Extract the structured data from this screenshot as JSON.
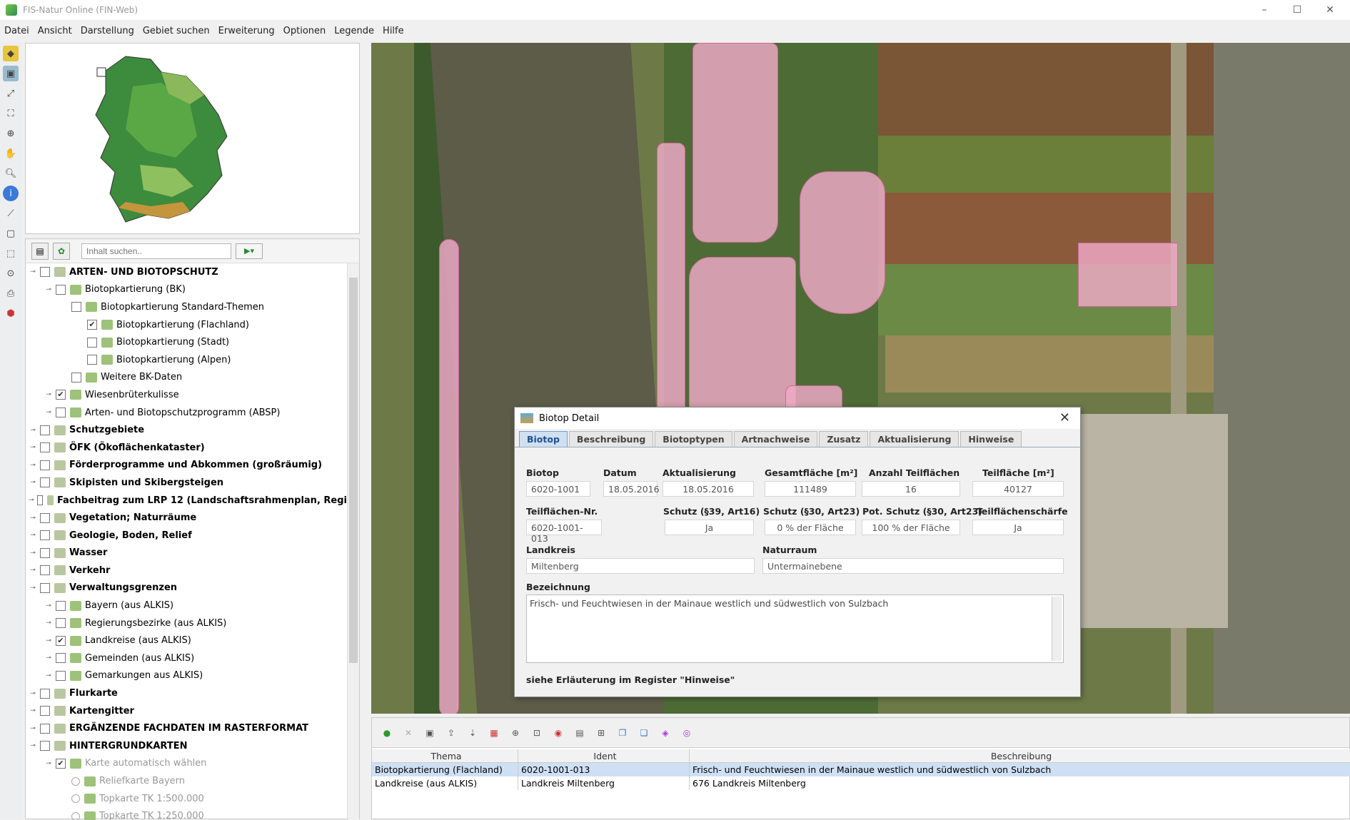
{
  "window": {
    "title": "FIS-Natur Online (FIN-Web)",
    "minimize": "–",
    "maximize": "☐",
    "close": "✕"
  },
  "menu": [
    "Datei",
    "Ansicht",
    "Darstellung",
    "Gebiet suchen",
    "Erweiterung",
    "Optionen",
    "Legende",
    "Hilfe"
  ],
  "tree": {
    "search_placeholder": "Inhalt suchen..",
    "items": [
      {
        "label": "ARTEN- UND BIOTOPSCHUTZ",
        "indent": 0,
        "checked": false,
        "bold": true
      },
      {
        "label": "Biotopkartierung (BK)",
        "indent": 1,
        "checked": false
      },
      {
        "label": "Biotopkartierung Standard-Themen",
        "indent": 2,
        "checked": false
      },
      {
        "label": "Biotopkartierung (Flachland)",
        "indent": 3,
        "checked": true
      },
      {
        "label": "Biotopkartierung (Stadt)",
        "indent": 3,
        "checked": false
      },
      {
        "label": "Biotopkartierung (Alpen)",
        "indent": 3,
        "checked": false
      },
      {
        "label": "Weitere BK-Daten",
        "indent": 2,
        "checked": false
      },
      {
        "label": "Wiesenbrüterkulisse",
        "indent": 1,
        "checked": true
      },
      {
        "label": "Arten- und Biotopschutzprogramm (ABSP)",
        "indent": 1,
        "checked": false
      },
      {
        "label": "Schutzgebiete",
        "indent": 0,
        "checked": false,
        "bold": true
      },
      {
        "label": "ÖFK (Ökoflächenkataster)",
        "indent": 0,
        "checked": false,
        "bold": true
      },
      {
        "label": "Förderprogramme und Abkommen (großräumig)",
        "indent": 0,
        "checked": false,
        "bold": true
      },
      {
        "label": "Skipisten und Skibergsteigen",
        "indent": 0,
        "checked": false,
        "bold": true
      },
      {
        "label": "Fachbeitrag zum LRP 12 (Landschaftsrahmenplan, Regi",
        "indent": 0,
        "checked": false,
        "bold": true
      },
      {
        "label": "Vegetation; Naturräume",
        "indent": 0,
        "checked": false,
        "bold": true
      },
      {
        "label": "Geologie, Boden, Relief",
        "indent": 0,
        "checked": false,
        "bold": true
      },
      {
        "label": "Wasser",
        "indent": 0,
        "checked": false,
        "bold": true
      },
      {
        "label": "Verkehr",
        "indent": 0,
        "checked": false,
        "bold": true
      },
      {
        "label": "Verwaltungsgrenzen",
        "indent": 0,
        "checked": false,
        "bold": true
      },
      {
        "label": "Bayern (aus ALKIS)",
        "indent": 1,
        "checked": false
      },
      {
        "label": "Regierungsbezirke (aus ALKIS)",
        "indent": 1,
        "checked": false
      },
      {
        "label": "Landkreise (aus ALKIS)",
        "indent": 1,
        "checked": true
      },
      {
        "label": "Gemeinden (aus ALKIS)",
        "indent": 1,
        "checked": false
      },
      {
        "label": "Gemarkungen aus ALKIS)",
        "indent": 1,
        "checked": false
      },
      {
        "label": "Flurkarte",
        "indent": 0,
        "checked": false,
        "bold": true
      },
      {
        "label": "Kartengitter",
        "indent": 0,
        "checked": false,
        "bold": true
      },
      {
        "label": "ERGÄNZENDE FACHDATEN IM RASTERFORMAT",
        "indent": 0,
        "checked": false,
        "bold": true
      },
      {
        "label": "HINTERGRUNDKARTEN",
        "indent": 0,
        "checked": false,
        "bold": true
      },
      {
        "label": "Karte automatisch wählen",
        "indent": 1,
        "checked": true,
        "grey": true
      },
      {
        "label": "Reliefkarte Bayern",
        "indent": 2,
        "radio": true,
        "grey": true
      },
      {
        "label": "Topkarte TK 1:500.000",
        "indent": 2,
        "radio": true,
        "grey": true
      },
      {
        "label": "Topkarte TK 1:250.000",
        "indent": 2,
        "radio": true,
        "grey": true
      }
    ]
  },
  "dialog": {
    "title": "Biotop Detail",
    "tabs": [
      "Biotop",
      "Beschreibung",
      "Biotoptypen",
      "Artnachweise",
      "Zusatz",
      "Aktualisierung",
      "Hinweise"
    ],
    "labels": {
      "biotop": "Biotop",
      "datum": "Datum",
      "aktualisierung": "Aktualisierung",
      "gesamtflaeche": "Gesamtfläche [m²]",
      "anzahl": "Anzahl Teilflächen",
      "teilflaeche": "Teilfläche [m²]",
      "teilflaechen_nr": "Teilflächen-Nr.",
      "schutz39": "Schutz (§39, Art16)",
      "schutz30": "Schutz (§30, Art23)",
      "pot_schutz": "Pot. Schutz (§30, Art23)",
      "schaerfe": "Teilflächenschärfe",
      "landkreis": "Landkreis",
      "naturraum": "Naturraum",
      "bezeichnung": "Bezeichnung"
    },
    "values": {
      "biotop": "6020-1001",
      "datum": "18.05.2016",
      "aktualisierung": "18.05.2016",
      "gesamtflaeche": "111489",
      "anzahl": "16",
      "teilflaeche": "40127",
      "teilflaechen_nr": "6020-1001-013",
      "schutz39": "Ja",
      "schutz30": "0 % der Fläche",
      "pot_schutz": "100 % der Fläche",
      "schaerfe": "Ja",
      "landkreis": "Miltenberg",
      "naturraum": "Untermainebene",
      "bezeichnung": "Frisch- und Feuchtwiesen in der Mainaue westlich und südwestlich von Sulzbach"
    },
    "footer": "siehe Erläuterung im Register \"Hinweise\""
  },
  "results": {
    "headers": [
      "Thema",
      "Ident",
      "Beschreibung"
    ],
    "rows": [
      [
        "Biotopkartierung (Flachland)",
        "6020-1001-013",
        "Frisch- und Feuchtwiesen in der Mainaue westlich und südwestlich von Sulzbach"
      ],
      [
        "Landkreise (aus ALKIS)",
        "Landkreis Miltenberg",
        "676 Landkreis Miltenberg"
      ]
    ]
  }
}
